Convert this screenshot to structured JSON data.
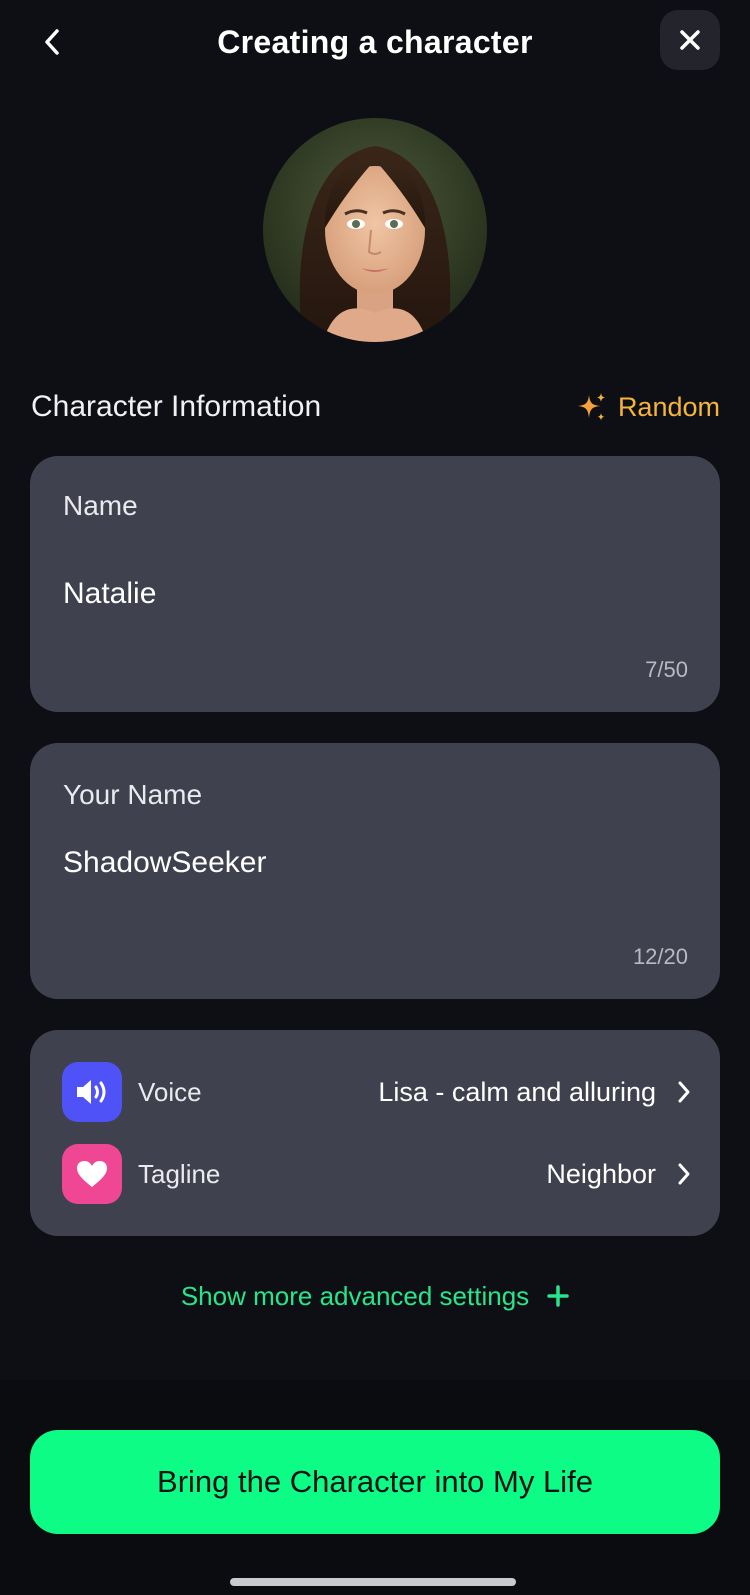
{
  "header": {
    "title": "Creating a character"
  },
  "section": {
    "title": "Character Information",
    "random_label": "Random"
  },
  "fields": {
    "name": {
      "label": "Name",
      "value": "Natalie",
      "counter": "7/50"
    },
    "your_name": {
      "label": "Your Name",
      "value": "ShadowSeeker",
      "counter": "12/20"
    }
  },
  "settings": {
    "voice": {
      "label": "Voice",
      "value": "Lisa - calm and alluring"
    },
    "tagline": {
      "label": "Tagline",
      "value": "Neighbor"
    }
  },
  "advanced": {
    "label": "Show more advanced settings"
  },
  "cta": {
    "label": "Bring the Character into My Life"
  },
  "colors": {
    "background": "#0e0f14",
    "card": "#40414f",
    "accent_green": "#0dfc86",
    "link_green": "#27e58a",
    "random_orange": "#f5b43a",
    "voice_icon_bg": "#4f52f6",
    "tagline_icon_bg": "#f04794"
  },
  "icons": {
    "back": "chevron-left-icon",
    "close": "close-icon",
    "random": "sparkle-icon",
    "voice": "speaker-icon",
    "tagline": "heart-icon",
    "row_chevron": "chevron-right-icon",
    "advanced": "plus-icon"
  }
}
